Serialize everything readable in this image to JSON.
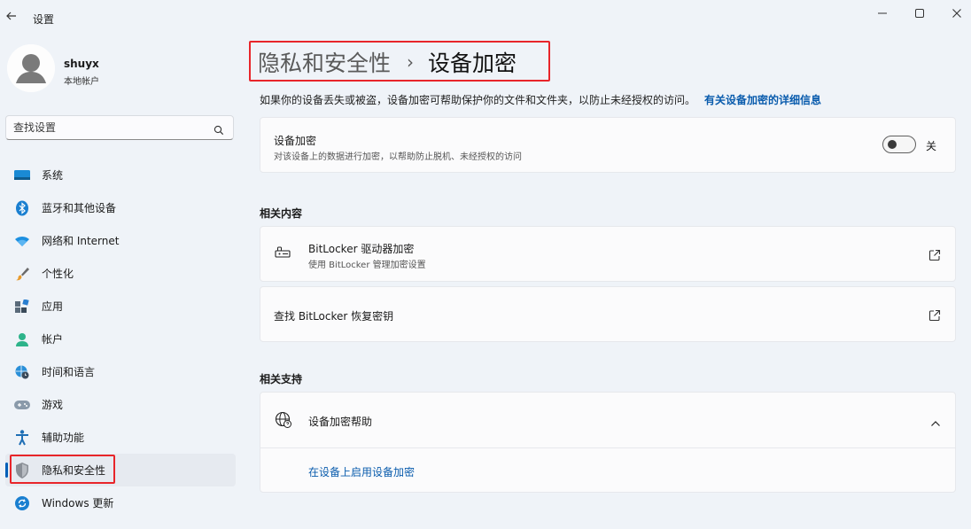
{
  "window": {
    "title": "设置"
  },
  "user": {
    "name": "shuyx",
    "account_type": "本地帐户"
  },
  "search": {
    "placeholder": "查找设置"
  },
  "sidebar": {
    "items": [
      {
        "label": "系统",
        "icon": "system-icon"
      },
      {
        "label": "蓝牙和其他设备",
        "icon": "bluetooth-icon"
      },
      {
        "label": "网络和 Internet",
        "icon": "wifi-icon"
      },
      {
        "label": "个性化",
        "icon": "brush-icon"
      },
      {
        "label": "应用",
        "icon": "apps-icon"
      },
      {
        "label": "帐户",
        "icon": "account-icon"
      },
      {
        "label": "时间和语言",
        "icon": "globe-clock-icon"
      },
      {
        "label": "游戏",
        "icon": "gamepad-icon"
      },
      {
        "label": "辅助功能",
        "icon": "accessibility-icon"
      },
      {
        "label": "隐私和安全性",
        "icon": "shield-icon",
        "active": true
      },
      {
        "label": "Windows 更新",
        "icon": "update-icon"
      }
    ]
  },
  "breadcrumb": {
    "parent": "隐私和安全性",
    "separator": "›",
    "current": "设备加密"
  },
  "intro": {
    "text": "如果你的设备丢失或被盗，设备加密可帮助保护你的文件和文件夹，以防止未经授权的访问。",
    "link": "有关设备加密的详细信息"
  },
  "encryption": {
    "title": "设备加密",
    "description": "对该设备上的数据进行加密，以帮助防止脱机、未经授权的访问",
    "toggle_state": "关",
    "enabled": false
  },
  "related_content": {
    "heading": "相关内容",
    "items": [
      {
        "title": "BitLocker 驱动器加密",
        "subtitle": "使用 BitLocker 管理加密设置",
        "icon": "bitlocker-key-icon"
      },
      {
        "title": "查找 BitLocker 恢复密钥"
      }
    ]
  },
  "related_support": {
    "heading": "相关支持",
    "help_title": "设备加密帮助",
    "help_link": "在设备上启用设备加密"
  },
  "colors": {
    "accent": "#005fb8",
    "link": "#0a5cad",
    "highlight": "#e8252a",
    "background": "#eff3f8"
  }
}
